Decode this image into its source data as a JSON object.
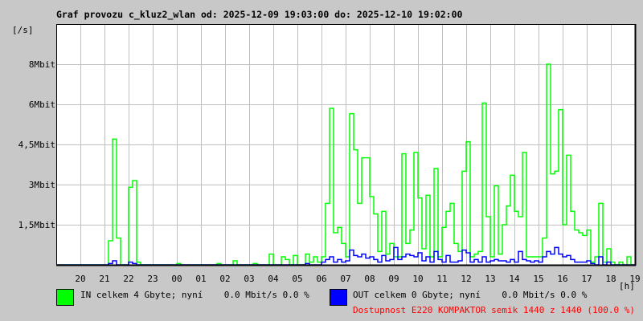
{
  "chart_data": {
    "type": "line",
    "title": "Graf provozu c_kluz2_wlan od: 2025-12-09 19:03:00 do: 2025-12-10 19:02:00",
    "ylabel": "[/s]",
    "xlabel": "[h]",
    "ylim_mbit": [
      0,
      9
    ],
    "y_ticks": [
      {
        "value": 1.5,
        "label": "1,5Mbit"
      },
      {
        "value": 3,
        "label": "3Mbit"
      },
      {
        "value": 4.5,
        "label": "4,5Mbit"
      },
      {
        "value": 6,
        "label": "6Mbit"
      },
      {
        "value": 7.5,
        "label": "8Mbit"
      }
    ],
    "x_tick_labels": [
      "20",
      "21",
      "22",
      "23",
      "00",
      "01",
      "02",
      "03",
      "04",
      "05",
      "06",
      "07",
      "08",
      "09",
      "10",
      "11",
      "12",
      "13",
      "14",
      "15",
      "16",
      "17",
      "18",
      "19"
    ],
    "x_range_hours": 24,
    "bin_minutes": 10,
    "grid": true,
    "series": [
      {
        "name": "IN",
        "color": "#00ff00",
        "unit": "Mbit/s",
        "values": [
          0,
          0,
          0,
          0,
          0,
          0,
          0,
          0,
          0,
          0,
          0,
          0,
          0,
          0.9,
          4.7,
          1.0,
          0,
          0,
          2.9,
          3.15,
          0.1,
          0,
          0,
          0,
          0,
          0,
          0,
          0,
          0,
          0,
          0.05,
          0,
          0,
          0,
          0,
          0,
          0,
          0,
          0,
          0,
          0.05,
          0,
          0,
          0,
          0.15,
          0,
          0,
          0,
          0,
          0.05,
          0,
          0,
          0,
          0.4,
          0,
          0,
          0.3,
          0.2,
          0,
          0.35,
          0,
          0,
          0.4,
          0.1,
          0.3,
          0.1,
          0.3,
          2.3,
          5.85,
          1.2,
          1.4,
          0.8,
          0.3,
          5.65,
          4.3,
          2.3,
          4.0,
          4.0,
          2.55,
          1.9,
          0.5,
          2.0,
          0.4,
          0.8,
          0.3,
          0.3,
          4.15,
          0.8,
          1.3,
          4.2,
          2.5,
          0.6,
          2.6,
          0.3,
          3.6,
          0.3,
          1.4,
          2.0,
          2.3,
          0.8,
          0.5,
          3.5,
          4.6,
          0.3,
          0.4,
          0.5,
          6.05,
          1.8,
          0.3,
          2.95,
          0.4,
          1.5,
          2.2,
          3.35,
          2.0,
          1.8,
          4.2,
          0.3,
          0.3,
          0.3,
          0.3,
          1.0,
          7.5,
          3.4,
          3.5,
          5.8,
          1.5,
          4.1,
          2.0,
          1.3,
          1.2,
          1.1,
          1.3,
          0.1,
          0.3,
          2.3,
          0.1,
          0.6,
          0.1,
          0,
          0.1,
          0,
          0.3,
          0
        ]
      },
      {
        "name": "OUT",
        "color": "#0000ff",
        "unit": "Mbit/s",
        "values": [
          0,
          0,
          0,
          0,
          0,
          0,
          0,
          0,
          0,
          0,
          0,
          0,
          0,
          0.05,
          0.15,
          0,
          0,
          0,
          0.1,
          0.05,
          0,
          0,
          0,
          0,
          0,
          0,
          0,
          0,
          0,
          0,
          0,
          0,
          0,
          0,
          0,
          0,
          0,
          0,
          0,
          0,
          0,
          0,
          0,
          0,
          0,
          0,
          0,
          0,
          0,
          0,
          0,
          0,
          0,
          0,
          0,
          0,
          0,
          0,
          0,
          0,
          0,
          0,
          0.05,
          0,
          0,
          0,
          0.1,
          0.2,
          0.3,
          0.1,
          0.2,
          0.1,
          0.15,
          0.55,
          0.35,
          0.3,
          0.4,
          0.25,
          0.3,
          0.2,
          0.1,
          0.35,
          0.15,
          0.2,
          0.65,
          0.2,
          0.3,
          0.4,
          0.35,
          0.3,
          0.45,
          0.15,
          0.3,
          0.1,
          0.5,
          0.2,
          0.1,
          0.35,
          0.1,
          0.1,
          0.15,
          0.55,
          0.45,
          0.1,
          0.2,
          0.1,
          0.3,
          0.1,
          0.15,
          0.2,
          0.15,
          0.15,
          0.1,
          0.2,
          0.1,
          0.5,
          0.2,
          0.15,
          0.1,
          0.15,
          0.1,
          0.3,
          0.5,
          0.4,
          0.65,
          0.4,
          0.3,
          0.35,
          0.2,
          0.1,
          0.1,
          0.1,
          0.15,
          0.05,
          0,
          0.3,
          0,
          0.1,
          0,
          0,
          0,
          0,
          0,
          0
        ]
      }
    ]
  },
  "legend": {
    "in_text": "IN celkem 4 Gbyte; nyní    0.0 Mbit/s 0.0 %",
    "out_text": "OUT celkem 0 Gbyte; nyní    0.0 Mbit/s 0.0 %",
    "availability": "Dostupnost E220 KOMPAKTOR semik 1440 z 1440 (100.0 %)",
    "availability_color": "#ff0000"
  }
}
